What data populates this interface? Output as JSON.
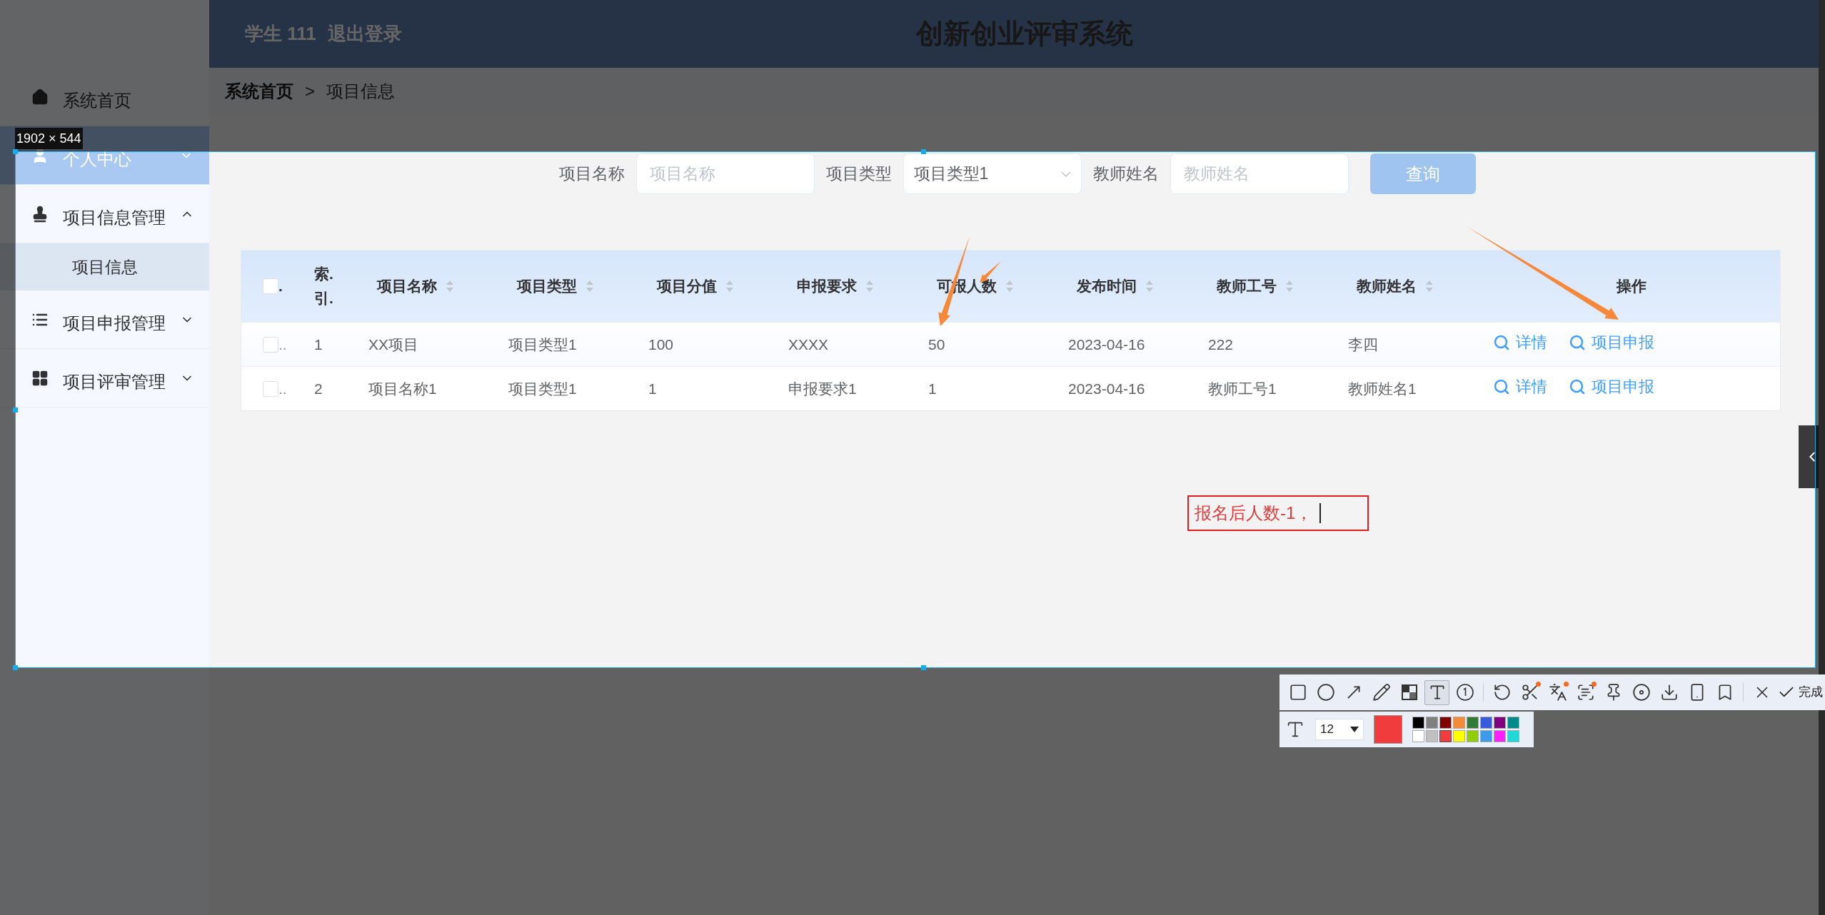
{
  "app_header": {
    "user": "学生 111",
    "logout": "退出登录",
    "title": "创新创业评审系统"
  },
  "sidebar": {
    "items": [
      {
        "kind": "link",
        "label": "系统首页",
        "highlighted": false
      },
      {
        "kind": "menu",
        "label": "个人中心",
        "highlighted": true,
        "expanded": false
      },
      {
        "kind": "menu",
        "label": "项目信息管理",
        "highlighted": false,
        "expanded": true,
        "children": [
          {
            "label": "项目信息",
            "selected": true
          }
        ]
      },
      {
        "kind": "menu",
        "label": "项目申报管理",
        "highlighted": false,
        "expanded": false
      },
      {
        "kind": "menu",
        "label": "项目评审管理",
        "highlighted": false,
        "expanded": false
      }
    ]
  },
  "breadcrumb": {
    "separator": ">",
    "items": [
      {
        "label": "系统首页",
        "current": false
      },
      {
        "label": "项目信息",
        "current": true
      }
    ]
  },
  "search_form": {
    "fields": [
      {
        "kind": "input",
        "label": "项目名称",
        "placeholder": "项目名称"
      },
      {
        "kind": "select",
        "label": "项目类型",
        "value": "项目类型1"
      },
      {
        "kind": "input",
        "label": "教师姓名",
        "placeholder": "教师姓名"
      }
    ],
    "button": "查询"
  },
  "table": {
    "select_all": {
      "checked": false,
      "trail": "."
    },
    "columns": [
      {
        "label": "索.引.",
        "sortable": false
      },
      {
        "label": "项目名称",
        "sortable": true
      },
      {
        "label": "项目类型",
        "sortable": true
      },
      {
        "label": "项目分值",
        "sortable": true
      },
      {
        "label": "申报要求",
        "sortable": true
      },
      {
        "label": "可报人数",
        "sortable": true
      },
      {
        "label": "发布时间",
        "sortable": true
      },
      {
        "label": "教师工号",
        "sortable": true
      },
      {
        "label": "教师姓名",
        "sortable": true
      },
      {
        "label": "操作",
        "sortable": false
      }
    ],
    "rows": [
      {
        "checked": false,
        "trail": "..",
        "cells": [
          "1",
          "XX项目",
          "项目类型1",
          "100",
          "XXXX",
          "50",
          "2023-04-16",
          "222",
          "李四"
        ],
        "actions": [
          "详情",
          "项目申报"
        ]
      },
      {
        "checked": false,
        "trail": "..",
        "cells": [
          "2",
          "项目名称1",
          "项目类型1",
          "1",
          "申报要求1",
          "1",
          "2023-04-16",
          "教师工号1",
          "教师姓名1"
        ],
        "actions": [
          "详情",
          "项目申报"
        ]
      }
    ]
  },
  "capture": {
    "size_label": "1902 × 544",
    "text_note": {
      "text": "报名后人数-1，",
      "editing": true
    },
    "toolbar": {
      "tools": [
        {
          "kind": "rectangle",
          "selected": false,
          "dot": false
        },
        {
          "kind": "ellipse",
          "selected": false,
          "dot": false
        },
        {
          "kind": "arrow",
          "selected": false,
          "dot": false
        },
        {
          "kind": "pencil",
          "selected": false,
          "dot": false
        },
        {
          "kind": "mosaic",
          "selected": false,
          "dot": false
        },
        {
          "kind": "text",
          "selected": true,
          "dot": false
        },
        {
          "kind": "number",
          "selected": false,
          "dot": false
        },
        {
          "kind": "separator"
        },
        {
          "kind": "undo",
          "selected": false,
          "dot": false
        },
        {
          "kind": "cut",
          "selected": false,
          "dot": true
        },
        {
          "kind": "translate",
          "selected": false,
          "dot": true
        },
        {
          "kind": "ocr",
          "selected": false,
          "dot": true
        },
        {
          "kind": "pin",
          "selected": false,
          "dot": false
        },
        {
          "kind": "record",
          "selected": false,
          "dot": false
        },
        {
          "kind": "download",
          "selected": false,
          "dot": false
        },
        {
          "kind": "phone",
          "selected": false,
          "dot": false
        },
        {
          "kind": "bookmark",
          "selected": false,
          "dot": false
        },
        {
          "kind": "separator"
        },
        {
          "kind": "close",
          "selected": false,
          "dot": false
        }
      ],
      "done_label": "完成",
      "font_size": "12",
      "palette": [
        {
          "color": "#000000",
          "selected": false
        },
        {
          "color": "#808080",
          "selected": false
        },
        {
          "color": "#800000",
          "selected": false
        },
        {
          "color": "#f28c38",
          "selected": false
        },
        {
          "color": "#2e7d32",
          "selected": false
        },
        {
          "color": "#3a5bd9",
          "selected": false
        },
        {
          "color": "#800080",
          "selected": false
        },
        {
          "color": "#008b8b",
          "selected": false
        },
        {
          "color": "#ffffff",
          "selected": false
        },
        {
          "color": "#c0c0c0",
          "selected": false
        },
        {
          "color": "#f03c3c",
          "selected": true
        },
        {
          "color": "#ffff00",
          "selected": false
        },
        {
          "color": "#8fcf00",
          "selected": false
        },
        {
          "color": "#3d9be9",
          "selected": false
        },
        {
          "color": "#ff1fff",
          "selected": false
        },
        {
          "color": "#1fd8d8",
          "selected": false
        }
      ]
    }
  }
}
